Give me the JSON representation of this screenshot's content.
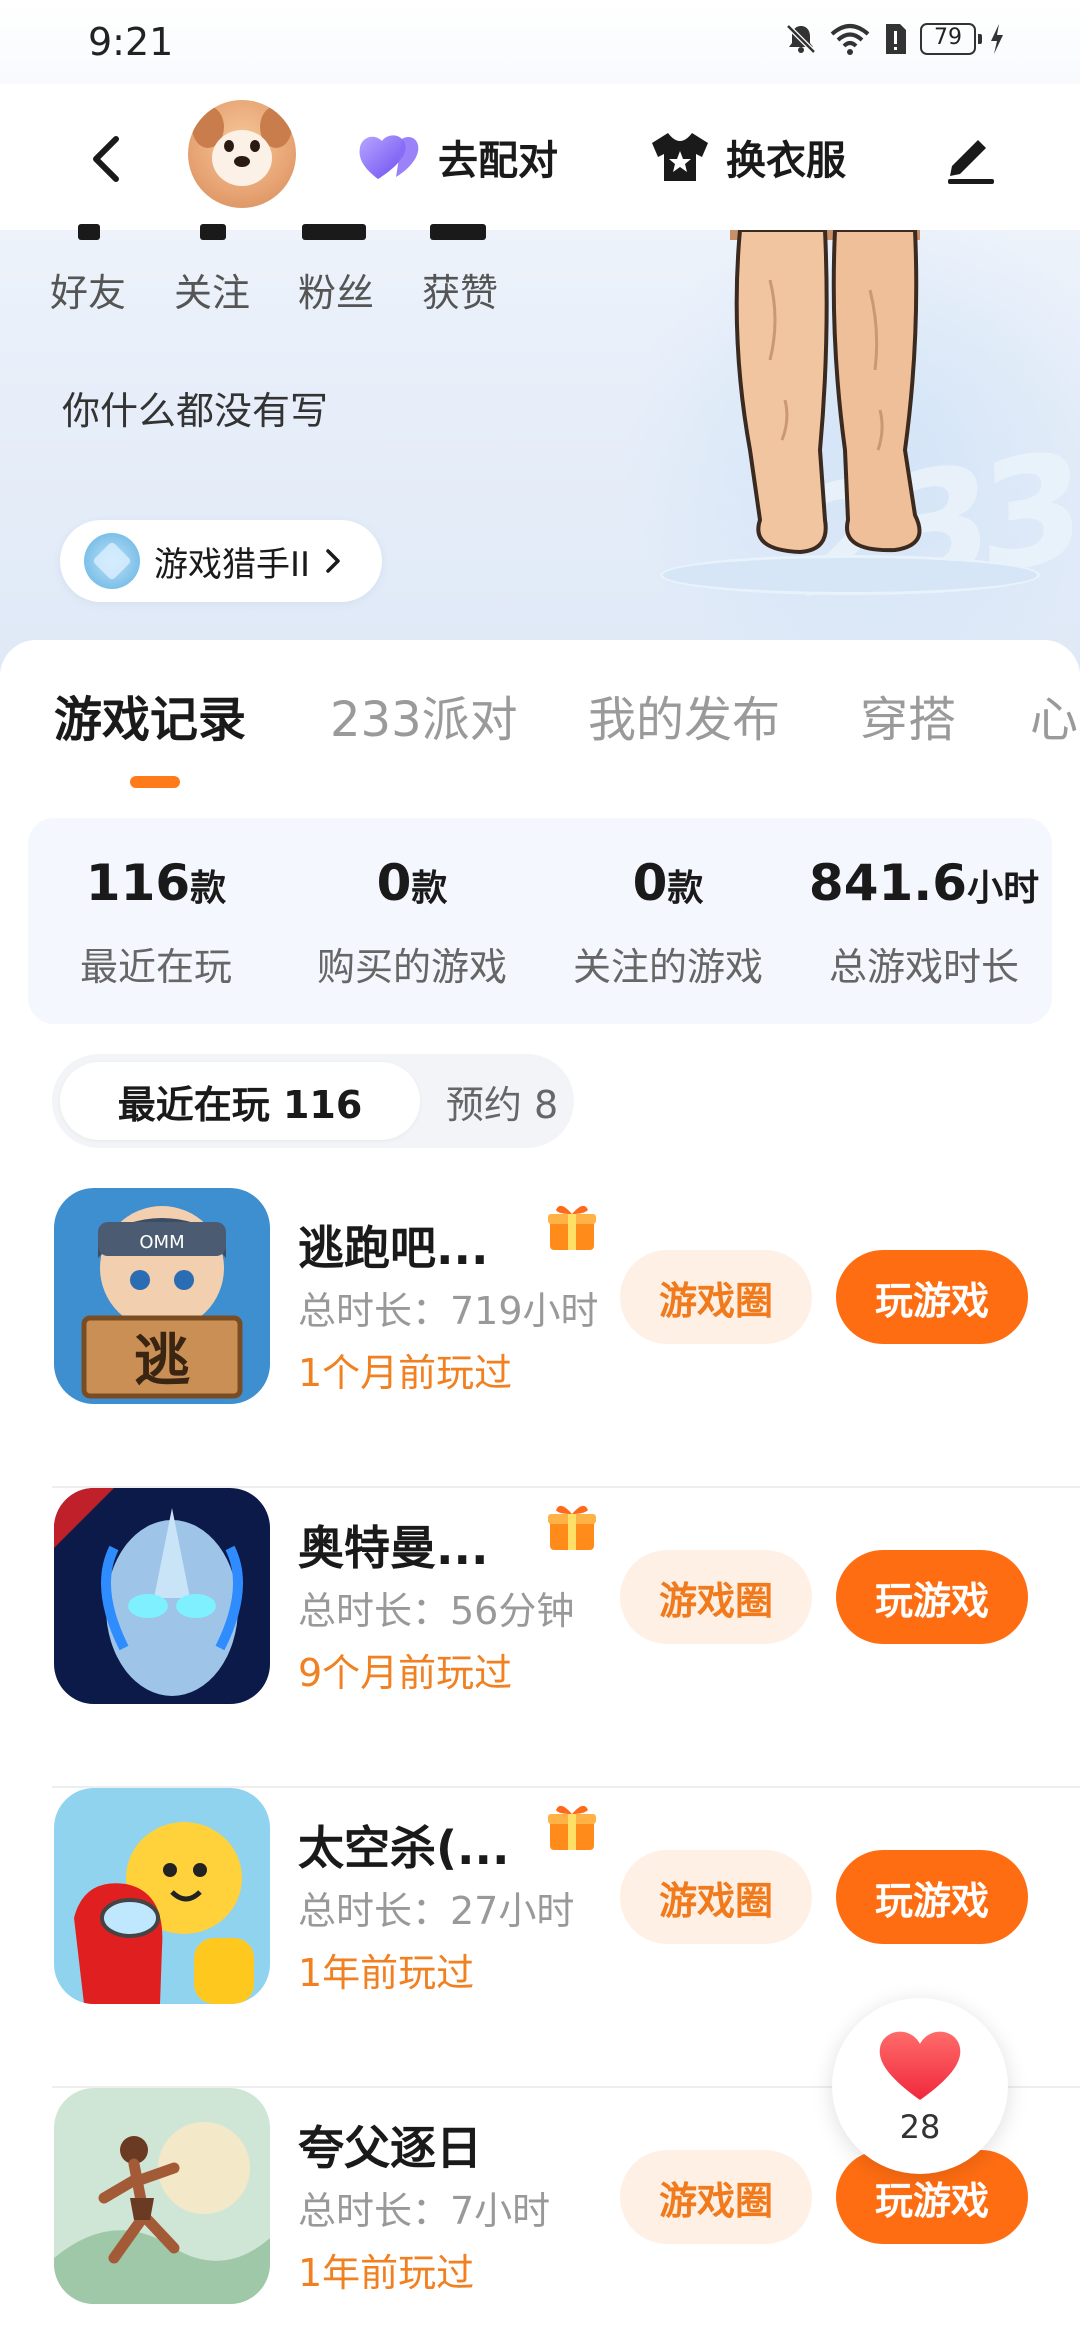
{
  "status_bar": {
    "time": "9:21",
    "battery": "79"
  },
  "header": {
    "pair_label": "去配对",
    "dress_label": "换衣服"
  },
  "profile": {
    "social": [
      {
        "label": "好友"
      },
      {
        "label": "关注"
      },
      {
        "label": "粉丝"
      },
      {
        "label": "获赞"
      }
    ],
    "bio": "你什么都没有写",
    "title_badge": "游戏猎手II"
  },
  "tabs": [
    "游戏记录",
    "233派对",
    "我的发布",
    "穿搭",
    "心"
  ],
  "summary": [
    {
      "value": "116",
      "unit": "款",
      "label": "最近在玩"
    },
    {
      "value": "0",
      "unit": "款",
      "label": "购买的游戏"
    },
    {
      "value": "0",
      "unit": "款",
      "label": "关注的游戏"
    },
    {
      "value": "841.6",
      "unit": "小时",
      "label": "总游戏时长"
    }
  ],
  "segments": {
    "recent": "最近在玩 116",
    "reserve": "预约 8"
  },
  "games": [
    {
      "name": "逃跑吧...",
      "duration": "总时长：719小时",
      "last_played": "1个月前玩过",
      "circle_label": "游戏圈",
      "play_label": "玩游戏",
      "icon": "fugitive-game-icon"
    },
    {
      "name": "奥特曼...",
      "duration": "总时长：56分钟",
      "last_played": "9个月前玩过",
      "circle_label": "游戏圈",
      "play_label": "玩游戏",
      "icon": "ultraman-game-icon"
    },
    {
      "name": "太空杀(...",
      "duration": "总时长：27小时",
      "last_played": "1年前玩过",
      "circle_label": "游戏圈",
      "play_label": "玩游戏",
      "icon": "space-kill-game-icon"
    },
    {
      "name": "夸父逐日",
      "duration": "总时长：7小时",
      "last_played": "1年前玩过",
      "circle_label": "游戏圈",
      "play_label": "玩游戏",
      "icon": "kuafu-game-icon"
    }
  ],
  "like": {
    "count": "28"
  },
  "colors": {
    "accent": "#ff6d12",
    "accent_soft": "#fff0e5",
    "played_text": "#f08020"
  }
}
